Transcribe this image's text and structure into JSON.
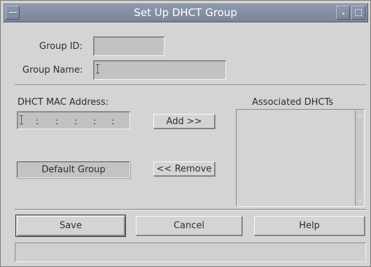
{
  "window": {
    "title": "Set Up DHCT Group"
  },
  "icons": {
    "window_menu": "window-menu-icon",
    "minimize": "minimize-icon",
    "maximize": "maximize-icon",
    "scroll_up": "arrow-up-icon",
    "scroll_down": "arrow-down-icon"
  },
  "form": {
    "group_id_label": "Group ID:",
    "group_id_value": "",
    "group_name_label": "Group Name:",
    "group_name_value": "",
    "mac_label": "DHCT MAC Address:",
    "mac_separators": [
      ":",
      ":",
      ":",
      ":",
      ":"
    ],
    "associated_label": "Associated DHCTs",
    "associated_items": []
  },
  "buttons": {
    "add": "Add >>",
    "remove": "<< Remove",
    "default_group": "Default Group",
    "save": "Save",
    "cancel": "Cancel",
    "help": "Help"
  },
  "status": {
    "text": ""
  },
  "colors": {
    "titlebar": "#7b869b",
    "window_bg": "#d4d4d4",
    "field_bg": "#c2c2c2"
  }
}
